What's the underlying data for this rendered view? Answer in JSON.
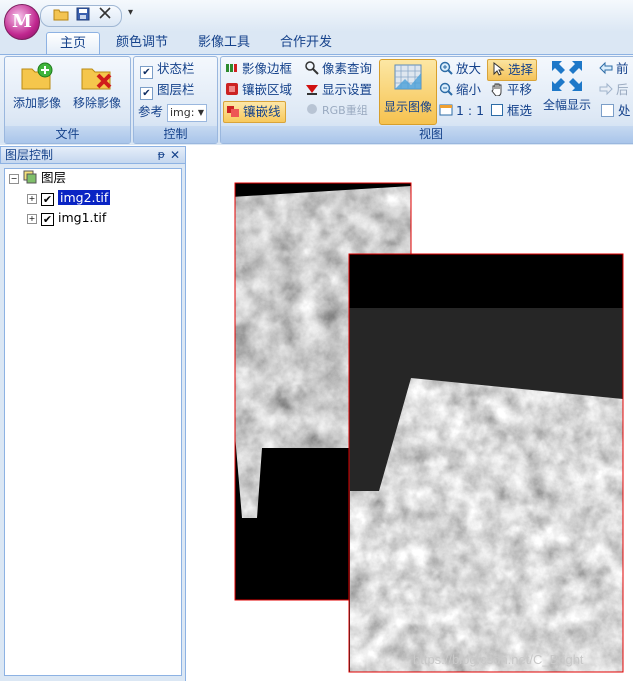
{
  "app": {
    "orb_letter": "M"
  },
  "tabs": [
    {
      "label": "主页"
    },
    {
      "label": "颜色调节"
    },
    {
      "label": "影像工具"
    },
    {
      "label": "合作开发"
    }
  ],
  "groups": {
    "file": {
      "label": "文件",
      "add": "添加影像",
      "remove": "移除影像"
    },
    "control": {
      "label": "控制",
      "statusbar": "状态栏",
      "layerbar": "图层栏",
      "ref_label": "参考",
      "ref_value": "img:"
    },
    "view": {
      "label": "视图",
      "img_border": "影像边框",
      "mosaic_area": "镶嵌区域",
      "mosaic_line": "镶嵌线",
      "pixel_query": "像素查询",
      "display_settings": "显示设置",
      "rgb_recombine": "RGB重组",
      "show_image": "显示图像",
      "zoom_in": "放大",
      "zoom_out": "缩小",
      "one_to_one": "1 : 1",
      "select": "选择",
      "pan": "平移",
      "box_select": "框选",
      "full_extent": "全幅显示",
      "forward": "前",
      "back": "后",
      "other": "处"
    }
  },
  "panel": {
    "title": "图层控制",
    "root": "图层",
    "layers": [
      {
        "name": "img2.tif",
        "checked": true,
        "selected": true
      },
      {
        "name": "img1.tif",
        "checked": true,
        "selected": false
      }
    ]
  },
  "watermark": "https://blog.csdn.net/C_Bright",
  "colors": {
    "ribbon_bg": "#dbe7f4",
    "accent_text": "#15428b",
    "selection": "#0a24c4",
    "image_outline": "#e00000"
  }
}
